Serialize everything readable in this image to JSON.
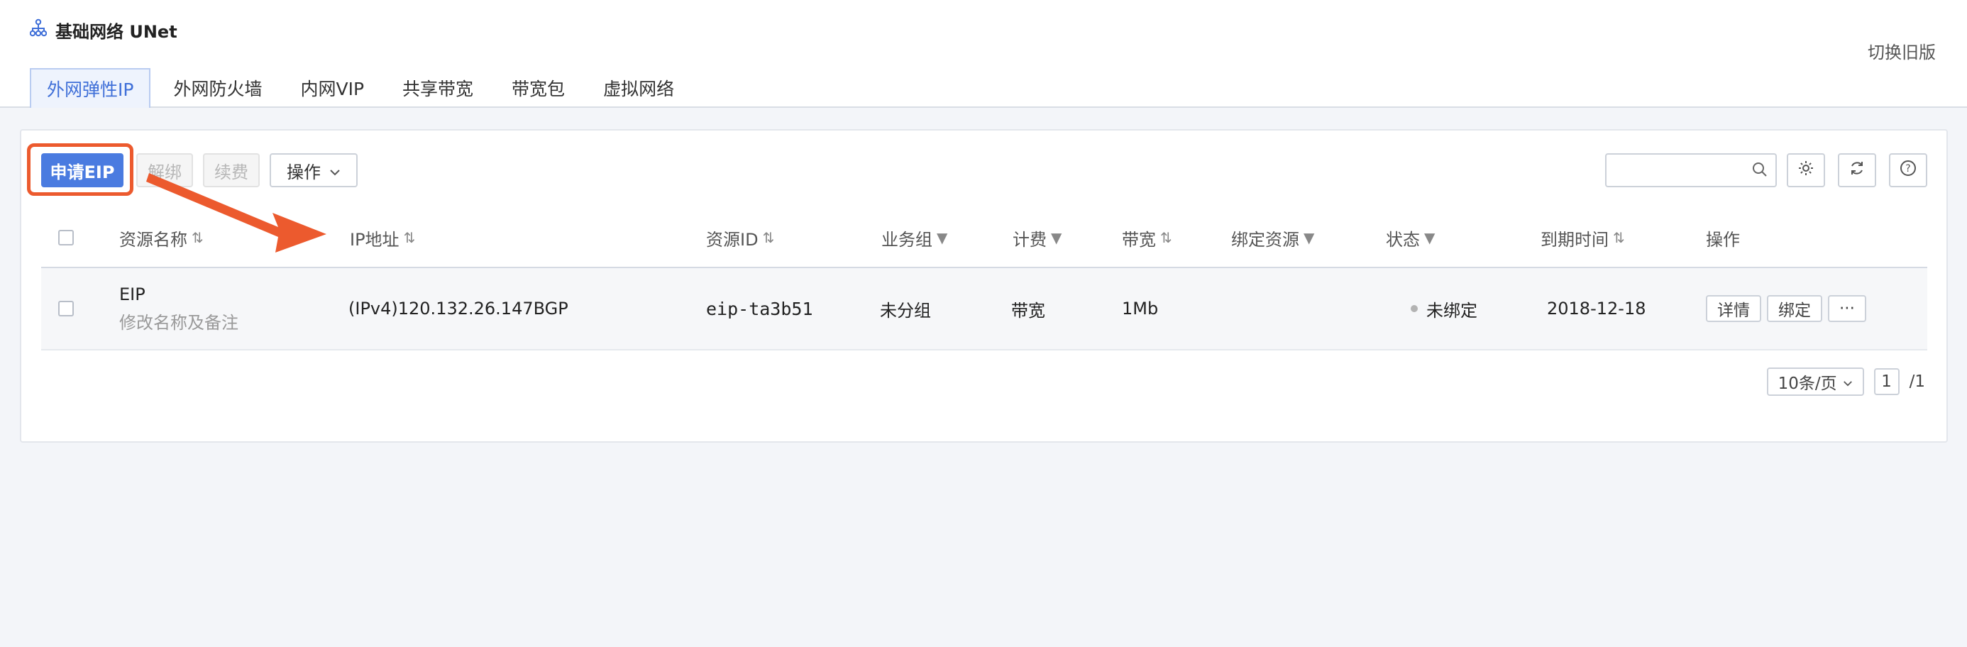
{
  "app": {
    "title": "基础网络 UNet",
    "switch_label": "切换旧版"
  },
  "tabs": [
    {
      "label": "外网弹性IP",
      "active": true
    },
    {
      "label": "外网防火墙"
    },
    {
      "label": "内网VIP"
    },
    {
      "label": "共享带宽"
    },
    {
      "label": "带宽包"
    },
    {
      "label": "虚拟网络"
    }
  ],
  "toolbar": {
    "apply_label": "申请EIP",
    "unbind_label": "解绑",
    "renew_label": "续费",
    "operate_label": "操作",
    "search_placeholder": ""
  },
  "table": {
    "columns": [
      "资源名称",
      "IP地址",
      "资源ID",
      "业务组",
      "计费",
      "带宽",
      "绑定资源",
      "状态",
      "到期时间",
      "操作"
    ],
    "rows": [
      {
        "name": "EIP",
        "remark": "修改名称及备注",
        "ip": "(IPv4)120.132.26.147BGP",
        "id": "eip-ta3b51",
        "group": "未分组",
        "billing": "带宽",
        "bandwidth": "1Mb",
        "bound": "",
        "status": "未绑定",
        "expire": "2018-12-18",
        "ops": {
          "detail": "详情",
          "bind": "绑定",
          "more": "···"
        }
      }
    ]
  },
  "pagination": {
    "page_size": "10条/页",
    "current": "1",
    "total": "/1"
  },
  "colors": {
    "accent": "#4a7be0",
    "highlight": "#ec5a2e"
  }
}
